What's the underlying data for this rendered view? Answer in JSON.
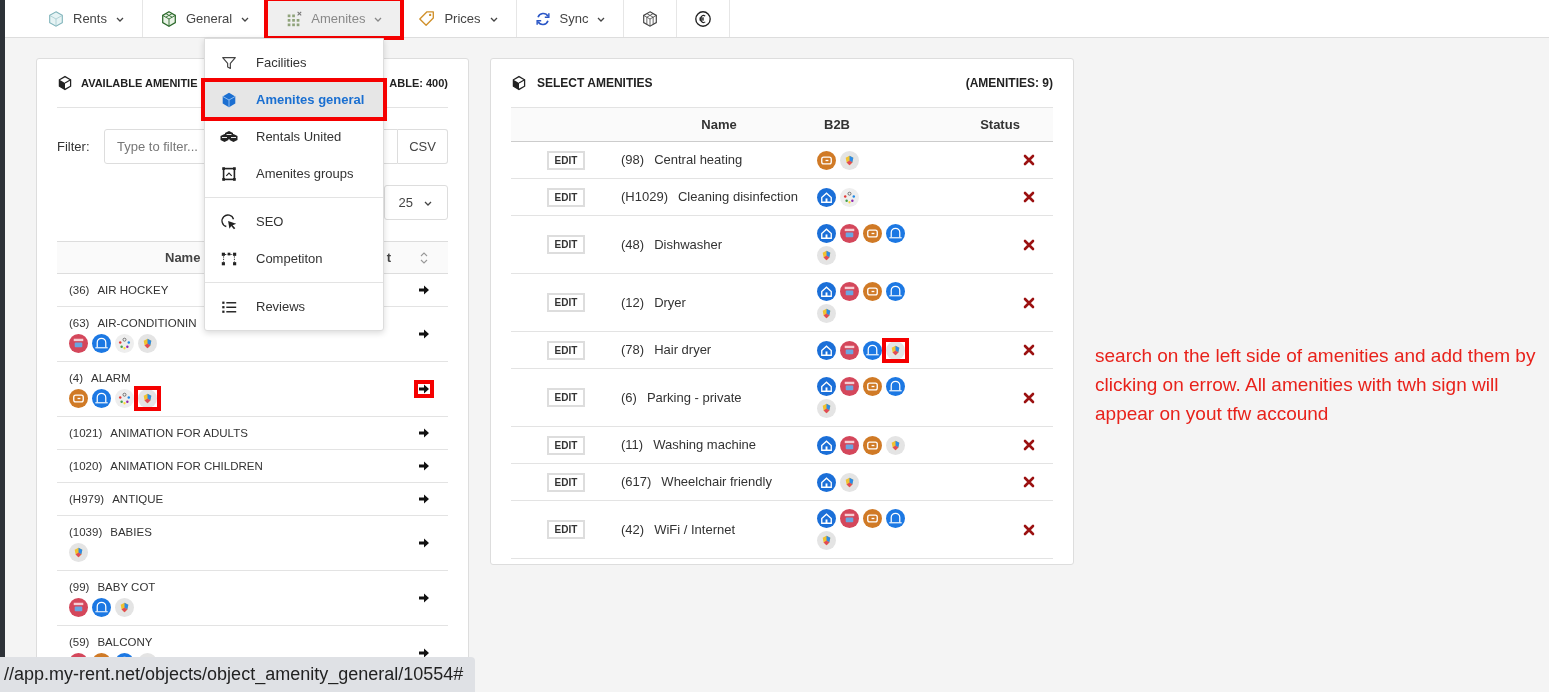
{
  "nav": [
    {
      "kind": "hexagon",
      "label": "Rents",
      "open": false,
      "marked": false
    },
    {
      "kind": "greencube",
      "label": "General",
      "open": false,
      "marked": false
    },
    {
      "kind": "grid",
      "label": "Amenites",
      "open": true,
      "marked": true
    },
    {
      "kind": "tag",
      "label": "Prices",
      "open": false,
      "marked": false
    },
    {
      "kind": "sync",
      "label": "Sync",
      "open": false,
      "marked": false
    },
    {
      "kind": "cube3d",
      "open": false,
      "marked": false
    },
    {
      "kind": "euro",
      "open": false,
      "marked": false
    }
  ],
  "menu": {
    "groups": [
      [
        {
          "kind": "funnel",
          "label": "Facilities",
          "selected": false,
          "marked": false
        },
        {
          "kind": "bluecube",
          "label": "Amenites general",
          "selected": true,
          "marked": true
        },
        {
          "kind": "cubes",
          "label": "Rentals United",
          "selected": false,
          "marked": false
        },
        {
          "kind": "frame",
          "label": "Amenites groups",
          "selected": false,
          "marked": false
        }
      ],
      [
        {
          "kind": "cursor",
          "label": "SEO",
          "selected": false,
          "marked": false
        },
        {
          "kind": "nodes",
          "label": "Competiton",
          "selected": false,
          "marked": false
        }
      ],
      [
        {
          "kind": "list",
          "label": "Reviews",
          "selected": false,
          "marked": false
        }
      ]
    ]
  },
  "available": {
    "title": "AVAILABLE AMENITIE",
    "count": "ABLE: 400)",
    "filter": {
      "label": "Filter:",
      "placeholder": "Type to filter..."
    },
    "export_button": "CSV",
    "page_size": "25",
    "columns": [
      "Name",
      "t"
    ],
    "rows": [
      {
        "code": "(36)",
        "name": "AIR HOCKEY",
        "arrow_marked": false,
        "channels": []
      },
      {
        "code": "(63)",
        "name": "AIR-CONDITIONIN",
        "arrow_marked": false,
        "channels": [
          {
            "kind": "home",
            "marked": false
          },
          {
            "kind": "arch",
            "marked": false
          },
          {
            "kind": "dots",
            "marked": false
          },
          {
            "kind": "twh",
            "marked": false
          }
        ]
      },
      {
        "code": "(4)",
        "name": "ALARM",
        "arrow_marked": true,
        "channels": [
          {
            "kind": "orange",
            "marked": false
          },
          {
            "kind": "arch",
            "marked": false
          },
          {
            "kind": "dots",
            "marked": false
          },
          {
            "kind": "twh",
            "marked": true
          }
        ]
      },
      {
        "code": "(1021)",
        "name": "ANIMATION FOR ADULTS",
        "arrow_marked": false,
        "channels": []
      },
      {
        "code": "(1020)",
        "name": "ANIMATION FOR CHILDREN",
        "arrow_marked": false,
        "channels": []
      },
      {
        "code": "(H979)",
        "name": "ANTIQUE",
        "arrow_marked": false,
        "channels": []
      },
      {
        "code": "(1039)",
        "name": "BABIES",
        "arrow_marked": false,
        "channels": [
          {
            "kind": "twh",
            "marked": false
          }
        ]
      },
      {
        "code": "(99)",
        "name": "BABY COT",
        "arrow_marked": false,
        "channels": [
          {
            "kind": "home",
            "marked": false
          },
          {
            "kind": "arch",
            "marked": false
          },
          {
            "kind": "twh",
            "marked": false
          }
        ]
      },
      {
        "code": "(59)",
        "name": "BALCONY",
        "arrow_marked": false,
        "channels": [
          {
            "kind": "home",
            "marked": false
          },
          {
            "kind": "orange",
            "marked": false
          },
          {
            "kind": "arch",
            "marked": false
          },
          {
            "kind": "twh",
            "marked": false
          }
        ]
      }
    ]
  },
  "selected_panel": {
    "title": "SELECT AMENITIES",
    "count": "(AMENITIES: 9)",
    "columns": [
      "Name",
      "B2B",
      "Status"
    ],
    "rows": [
      {
        "edit": "EDIT",
        "code": "(98)",
        "name": "Central heating",
        "channels": [
          {
            "kind": "orange",
            "marked": false
          },
          {
            "kind": "twh",
            "marked": false
          }
        ]
      },
      {
        "edit": "EDIT",
        "code": "(H1029)",
        "name": "Cleaning disinfection",
        "channels": [
          {
            "kind": "house",
            "marked": false
          },
          {
            "kind": "dots",
            "marked": false
          }
        ]
      },
      {
        "edit": "EDIT",
        "code": "(48)",
        "name": "Dishwasher",
        "channels": [
          {
            "kind": "house",
            "marked": false
          },
          {
            "kind": "home",
            "marked": false
          },
          {
            "kind": "orange",
            "marked": false
          },
          {
            "kind": "arch",
            "marked": false
          },
          {
            "kind": "twh",
            "marked": false
          }
        ]
      },
      {
        "edit": "EDIT",
        "code": "(12)",
        "name": "Dryer",
        "channels": [
          {
            "kind": "house",
            "marked": false
          },
          {
            "kind": "home",
            "marked": false
          },
          {
            "kind": "orange",
            "marked": false
          },
          {
            "kind": "arch",
            "marked": false
          },
          {
            "kind": "twh",
            "marked": false
          }
        ]
      },
      {
        "edit": "EDIT",
        "code": "(78)",
        "name": "Hair dryer",
        "channels": [
          {
            "kind": "house",
            "marked": false
          },
          {
            "kind": "home",
            "marked": false
          },
          {
            "kind": "arch",
            "marked": false
          },
          {
            "kind": "twh",
            "marked": true
          }
        ]
      },
      {
        "edit": "EDIT",
        "code": "(6)",
        "name": "Parking - private",
        "channels": [
          {
            "kind": "house",
            "marked": false
          },
          {
            "kind": "home",
            "marked": false
          },
          {
            "kind": "orange",
            "marked": false
          },
          {
            "kind": "arch",
            "marked": false
          },
          {
            "kind": "twh",
            "marked": false
          }
        ]
      },
      {
        "edit": "EDIT",
        "code": "(11)",
        "name": "Washing machine",
        "channels": [
          {
            "kind": "house",
            "marked": false
          },
          {
            "kind": "home",
            "marked": false
          },
          {
            "kind": "orange",
            "marked": false
          },
          {
            "kind": "twh",
            "marked": false
          }
        ]
      },
      {
        "edit": "EDIT",
        "code": "(617)",
        "name": "Wheelchair friendly",
        "channels": [
          {
            "kind": "house",
            "marked": false
          },
          {
            "kind": "twh",
            "marked": false
          }
        ]
      },
      {
        "edit": "EDIT",
        "code": "(42)",
        "name": "WiFi / Internet",
        "channels": [
          {
            "kind": "house",
            "marked": false
          },
          {
            "kind": "home",
            "marked": false
          },
          {
            "kind": "orange",
            "marked": false
          },
          {
            "kind": "arch",
            "marked": false
          },
          {
            "kind": "twh",
            "marked": false
          }
        ]
      }
    ]
  },
  "note": "search on the left side of amenities and add them by clicking on errow. All amenities with twh sign will appear on yout tfw accound",
  "status_url": "//app.my-rent.net/objects/object_amenity_general/10554#"
}
